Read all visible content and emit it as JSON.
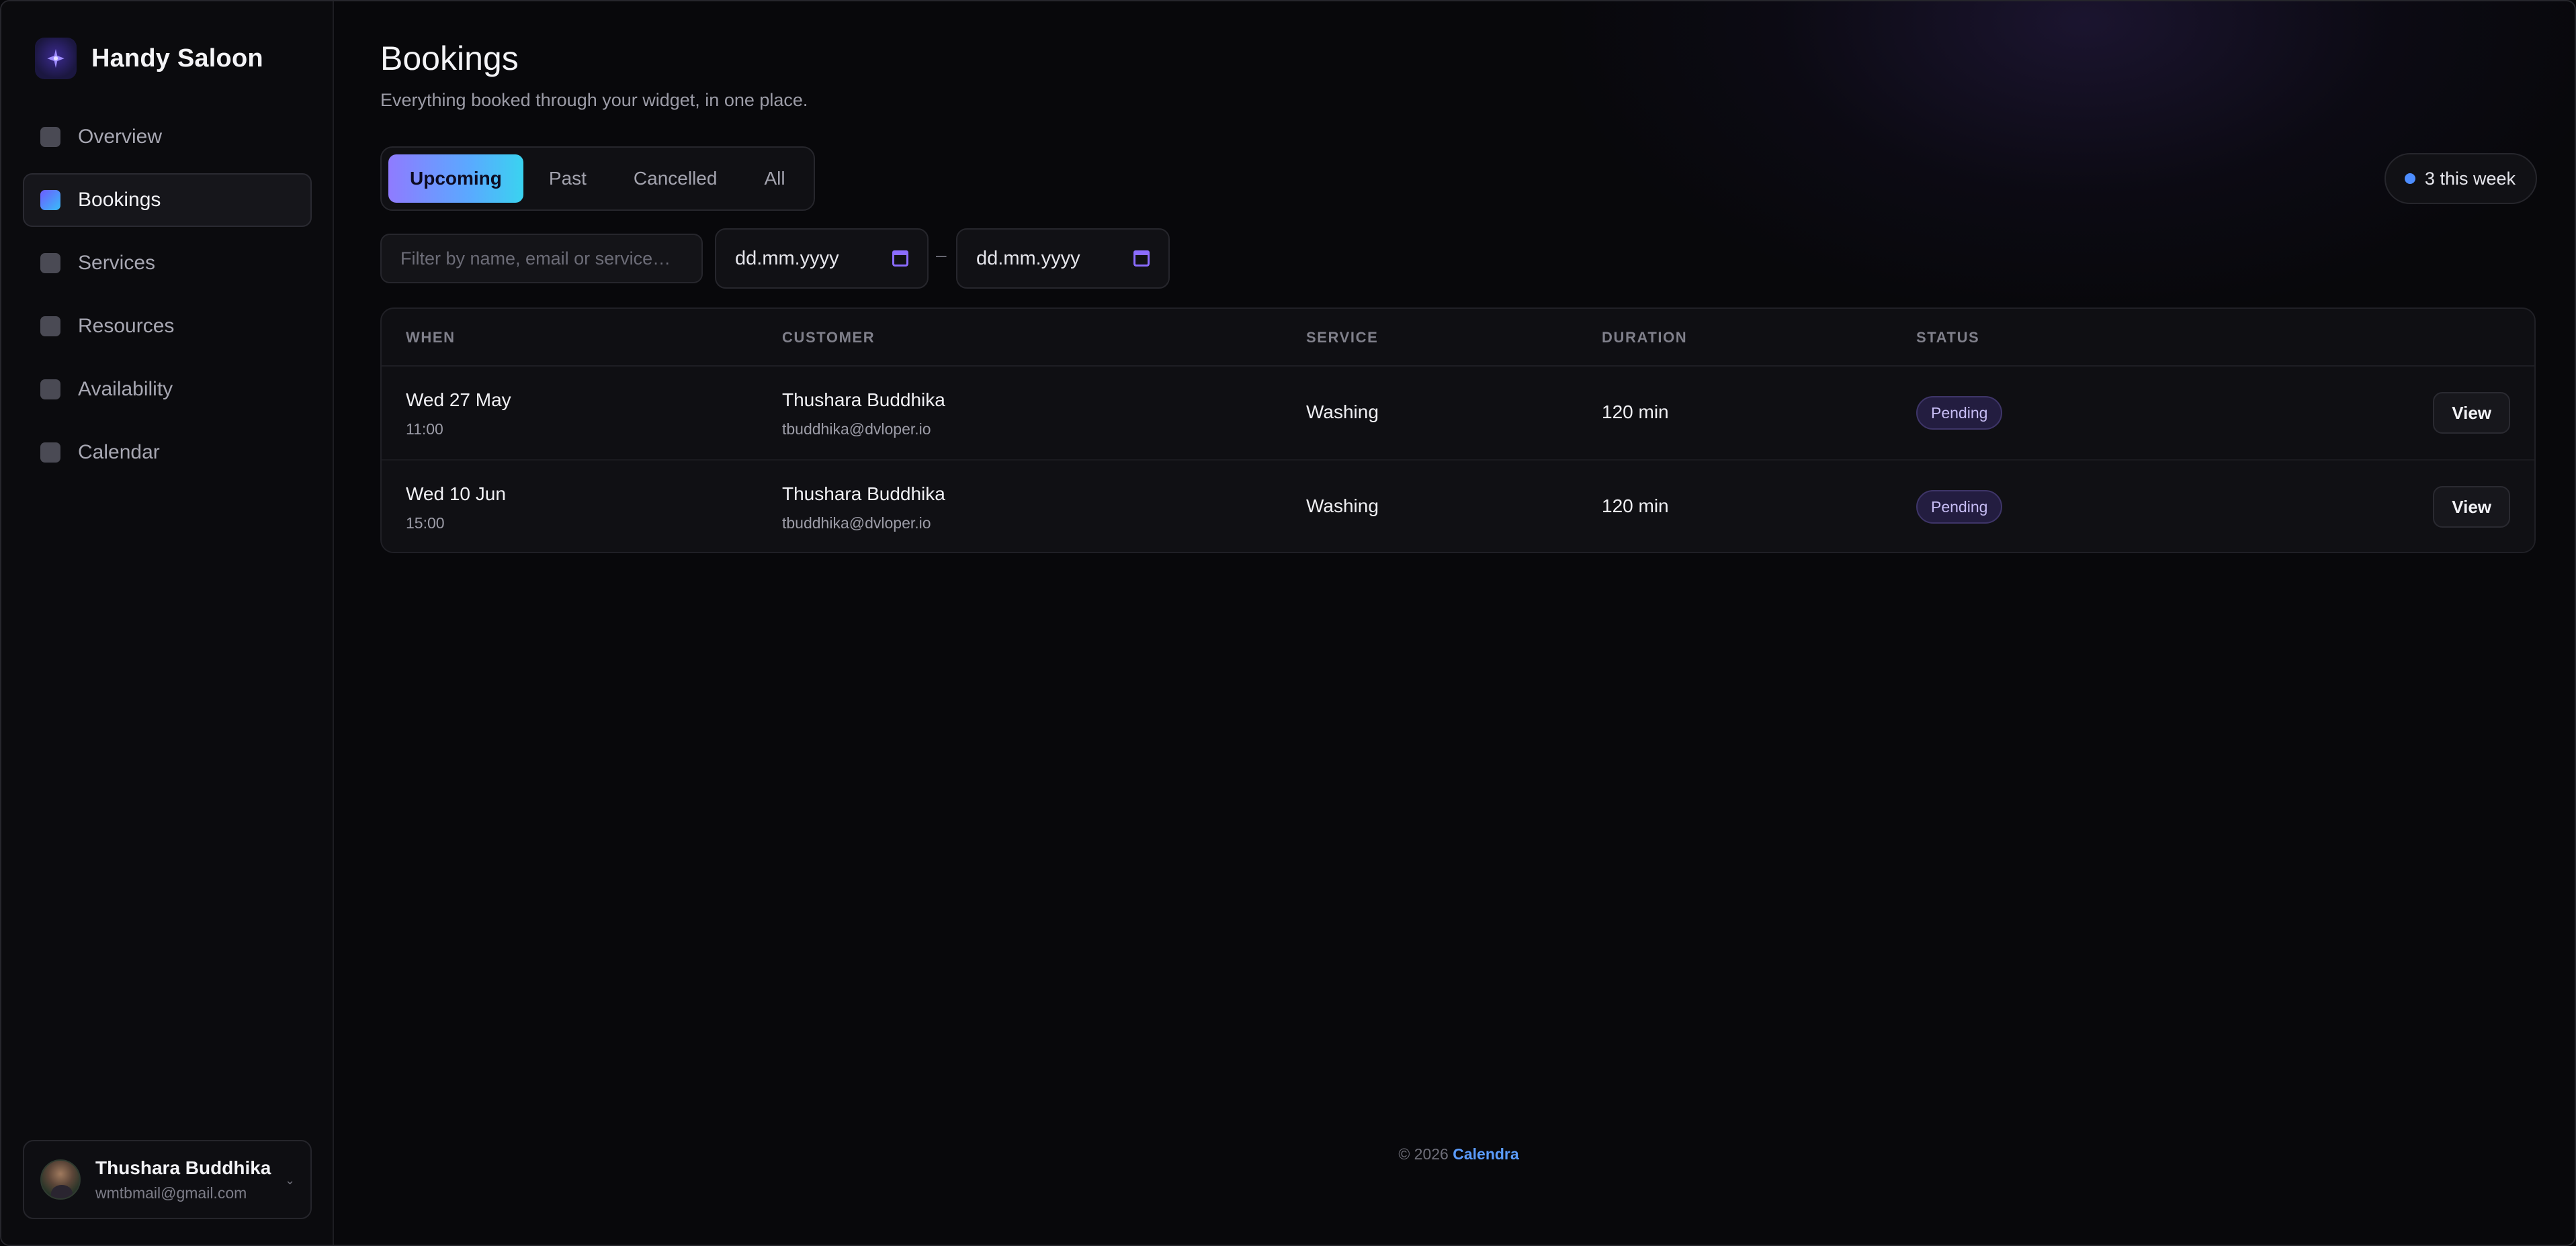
{
  "brand": {
    "name": "Handy Saloon",
    "logo_icon": "sparkle-icon"
  },
  "sidebar": {
    "items": [
      {
        "label": "Overview",
        "active": false
      },
      {
        "label": "Bookings",
        "active": true
      },
      {
        "label": "Services",
        "active": false
      },
      {
        "label": "Resources",
        "active": false
      },
      {
        "label": "Availability",
        "active": false
      },
      {
        "label": "Calendar",
        "active": false
      }
    ]
  },
  "user": {
    "name": "Thushara Buddhika",
    "email": "wmtbmail@gmail.com"
  },
  "page": {
    "title": "Bookings",
    "subtitle": "Everything booked through your widget, in one place."
  },
  "tabs": [
    {
      "label": "Upcoming",
      "active": true
    },
    {
      "label": "Past",
      "active": false
    },
    {
      "label": "Cancelled",
      "active": false
    },
    {
      "label": "All",
      "active": false
    }
  ],
  "week_badge": {
    "label": "3 this week"
  },
  "filters": {
    "search_placeholder": "Filter by name, email or service…",
    "date_from": "dd.mm.yyyy",
    "date_to": "dd.mm.yyyy",
    "separator": "–"
  },
  "table": {
    "headers": {
      "when": "WHEN",
      "customer": "CUSTOMER",
      "service": "SERVICE",
      "duration": "DURATION",
      "status": "STATUS"
    },
    "rows": [
      {
        "day": "Wed 27 May",
        "time": "11:00",
        "customer_name": "Thushara Buddhika",
        "customer_email": "tbuddhika@dvloper.io",
        "service": "Washing",
        "duration": "120 min",
        "status": "Pending",
        "action": "View"
      },
      {
        "day": "Wed 10 Jun",
        "time": "15:00",
        "customer_name": "Thushara Buddhika",
        "customer_email": "tbuddhika@dvloper.io",
        "service": "Washing",
        "duration": "120 min",
        "status": "Pending",
        "action": "View"
      }
    ]
  },
  "footer": {
    "copyright": "© 2026",
    "link": "Calendra"
  },
  "colors": {
    "accent_start": "#8f7bff",
    "accent_end": "#3ad3f0",
    "link": "#5b9cff",
    "pending_badge": "#231d40"
  }
}
